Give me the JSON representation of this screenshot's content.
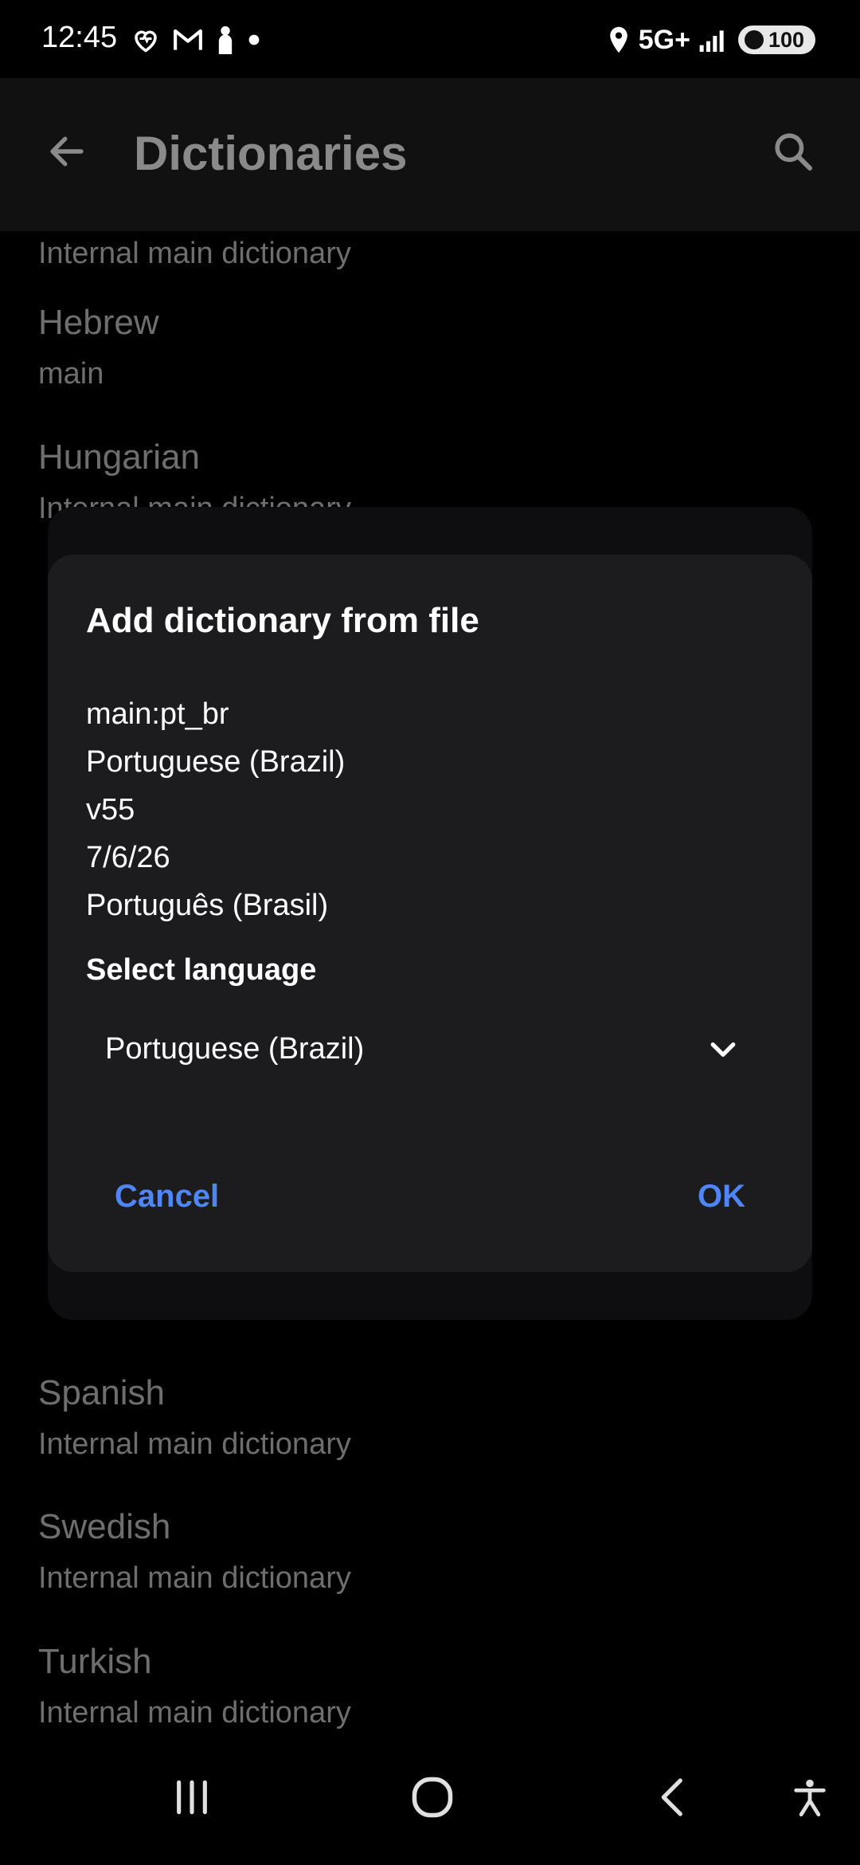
{
  "status_bar": {
    "time": "12:45",
    "left_icons": [
      "health-icon",
      "gmail-icon",
      "person-icon",
      "dot-icon"
    ],
    "network": "5G+",
    "battery": "100"
  },
  "app_bar": {
    "title": "Dictionaries"
  },
  "list": {
    "items": [
      {
        "title": "",
        "subtitle": "Internal main dictionary"
      },
      {
        "title": "Hebrew",
        "subtitle": "main"
      },
      {
        "title": "Hungarian",
        "subtitle": "Internal main dictionary"
      },
      {
        "title": "Spanish",
        "subtitle": "Internal main dictionary"
      },
      {
        "title": "Swedish",
        "subtitle": "Internal main dictionary"
      },
      {
        "title": "Turkish",
        "subtitle": "Internal main dictionary"
      }
    ]
  },
  "dialog": {
    "title": "Add dictionary from file",
    "info": [
      "main:pt_br",
      "Portuguese (Brazil)",
      "v55",
      "7/6/26",
      "Português (Brasil)"
    ],
    "select_label": "Select language",
    "selected_language": "Portuguese (Brazil)",
    "cancel_label": "Cancel",
    "ok_label": "OK"
  },
  "colors": {
    "accent": "#4f86f7",
    "dialog_bg": "#1c1c1f",
    "app_bar_bg": "#111111",
    "dim_text": "#6e6e6e"
  }
}
